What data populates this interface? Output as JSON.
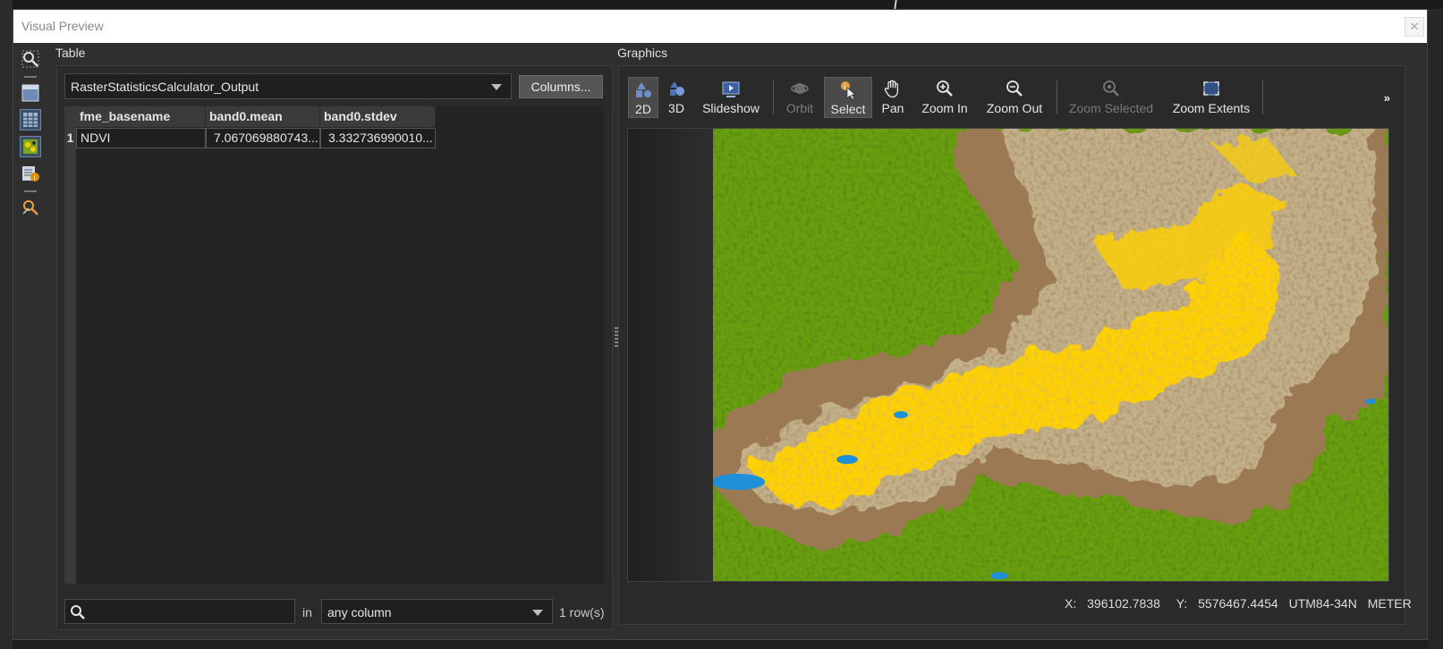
{
  "window": {
    "title": "Visual Preview",
    "close_glyph": "✕"
  },
  "side_toolbar": {
    "icons": [
      "inspect-icon",
      "layout-icon",
      "table-view-icon",
      "graphics-view-icon",
      "feature-info-icon",
      "tools-icon"
    ]
  },
  "table": {
    "panel_label": "Table",
    "dataset": "RasterStatisticsCalculator_Output",
    "columns_button": "Columns...",
    "headers": [
      "fme_basename",
      "band0.mean",
      "band0.stdev"
    ],
    "rows": [
      {
        "num": "1",
        "cells": [
          "NDVI",
          "7.067069880743...",
          "3.332736990010..."
        ]
      }
    ],
    "search": {
      "value": "",
      "placeholder": ""
    },
    "in_label": "in",
    "column_filter": "any column",
    "row_count": "1 row(s)"
  },
  "graphics": {
    "panel_label": "Graphics",
    "tools": [
      {
        "label": "2D",
        "icon": "2d-icon",
        "state": "active"
      },
      {
        "label": "3D",
        "icon": "3d-icon",
        "state": "normal"
      },
      {
        "label": "Slideshow",
        "icon": "slideshow-icon",
        "state": "normal"
      },
      {
        "label": "Orbit",
        "icon": "orbit-icon",
        "state": "disabled"
      },
      {
        "label": "Select",
        "icon": "select-icon",
        "state": "active"
      },
      {
        "label": "Pan",
        "icon": "pan-hand-icon",
        "state": "normal"
      },
      {
        "label": "Zoom In",
        "icon": "zoom-in-icon",
        "state": "normal"
      },
      {
        "label": "Zoom Out",
        "icon": "zoom-out-icon",
        "state": "normal"
      },
      {
        "label": "Zoom Selected",
        "icon": "zoom-selected-icon",
        "state": "disabled"
      },
      {
        "label": "Zoom Extents",
        "icon": "zoom-extents-icon",
        "state": "normal"
      }
    ],
    "more_glyph": "»",
    "status": {
      "x_label": "X:",
      "x_value": "396102.7838",
      "y_label": "Y:",
      "y_value": "5576467.4454",
      "crs": "UTM84-34N",
      "units": "METER"
    }
  },
  "colors": {
    "ndvi_green": "#6a9e10",
    "ndvi_dark_green": "#3f7a12",
    "ndvi_brown": "#9b7a52",
    "ndvi_tan": "#c2b08a",
    "ndvi_yellow": "#ffd000",
    "water_blue": "#1e8fd8"
  }
}
